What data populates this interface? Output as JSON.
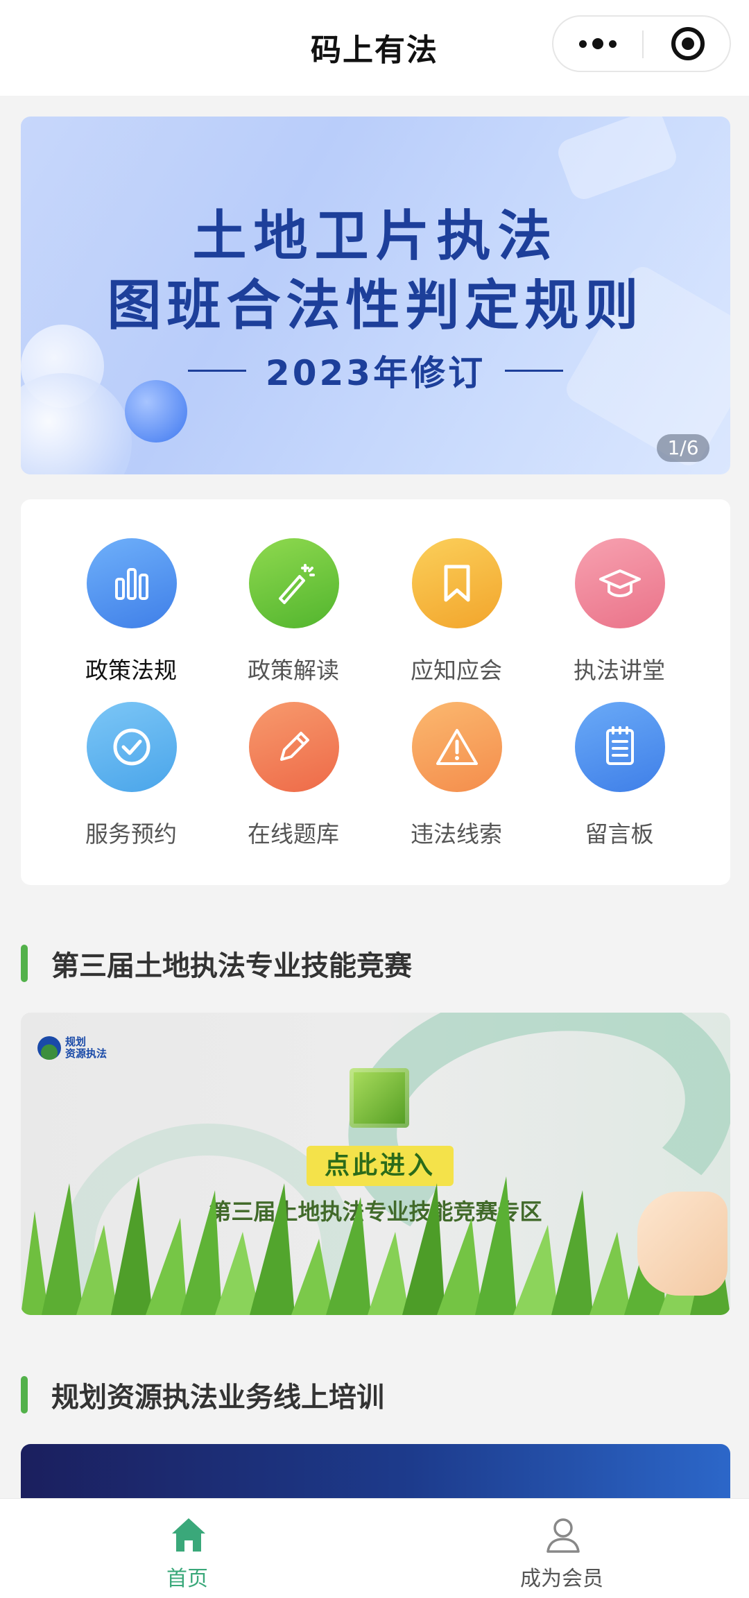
{
  "navbar": {
    "title": "码上有法",
    "more_icon": "more-dots-icon",
    "close_icon": "target-icon"
  },
  "banner": {
    "line1": "土地卫片执法",
    "line2": "图班合法性判定规则",
    "line3": "2023年修订",
    "pager": "1/6"
  },
  "grid": [
    {
      "label": "政策法规",
      "icon": "bar-chart-icon",
      "color": "#4a8ef0"
    },
    {
      "label": "政策解读",
      "icon": "magic-wand-icon",
      "color": "#6cc63a"
    },
    {
      "label": "应知应会",
      "icon": "bookmark-icon",
      "color": "#f5b63a"
    },
    {
      "label": "执法讲堂",
      "icon": "graduation-cap-icon",
      "color": "#ef8a9c"
    },
    {
      "label": "服务预约",
      "icon": "check-circle-icon",
      "color": "#5ab0ee"
    },
    {
      "label": "在线题库",
      "icon": "pencil-icon",
      "color": "#f27d55"
    },
    {
      "label": "违法线索",
      "icon": "warning-icon",
      "color": "#f7a45c"
    },
    {
      "label": "留言板",
      "icon": "notepad-icon",
      "color": "#4f97ef"
    }
  ],
  "sections": {
    "competition_title": "第三届土地执法专业技能竞赛",
    "training_title": "规划资源执法业务线上培训"
  },
  "competition_banner": {
    "logo_line1": "规划",
    "logo_line2": "资源执法",
    "button": "点此进入",
    "subtitle": "第三届土地执法专业技能竞赛专区"
  },
  "tabbar": {
    "home": "首页",
    "member": "成为会员",
    "active_color": "#3aa87a"
  }
}
